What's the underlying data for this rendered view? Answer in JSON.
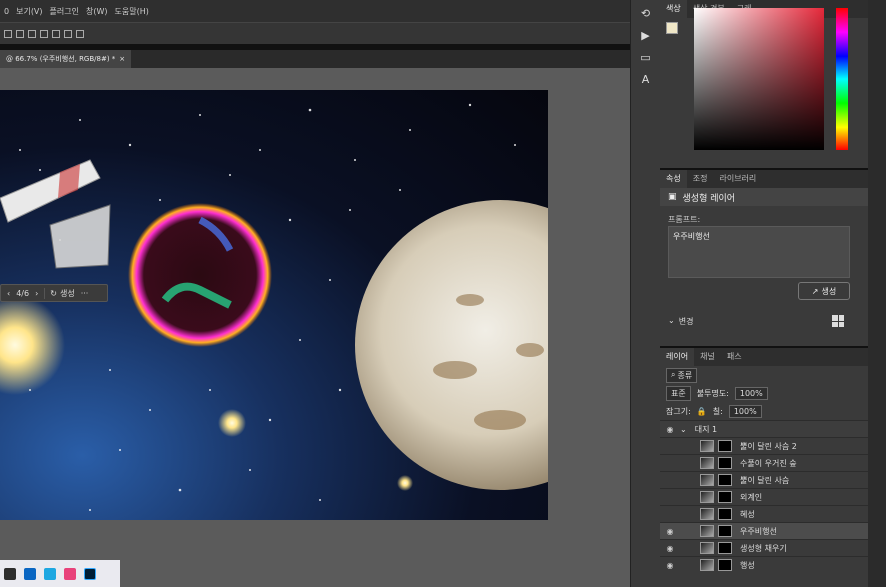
{
  "menubar": {
    "items": [
      "0",
      "보기(V)",
      "플러그인",
      "창(W)",
      "도움말(H)"
    ]
  },
  "document": {
    "tab_title": "@ 66.7% (우주비행선, RGB/8#) *",
    "close": "×"
  },
  "context_bar": {
    "prev": "‹",
    "counter": "4/6",
    "next": "›",
    "generate": "생성",
    "more": "···"
  },
  "color_panel": {
    "tabs": [
      "색상",
      "색상 견본",
      "그레"
    ],
    "foreground": "#f0e7c7",
    "background": "#ffffff"
  },
  "properties": {
    "tabs": [
      "속성",
      "조정",
      "라이브러리"
    ],
    "layer_type": "생성형 레이어",
    "prompt_label": "프롬프트:",
    "prompt_value": "우주비행선",
    "generate_button": "생성",
    "variations_label": "변경"
  },
  "layers": {
    "tabs": [
      "레이어",
      "채널",
      "패스"
    ],
    "filter": "종류",
    "blend_mode": "표준",
    "opacity_label": "불투명도:",
    "opacity": "100%",
    "lock_label": "잠그기:",
    "fill_label": "칠:",
    "fill": "100%",
    "items": [
      {
        "name": "대지 1",
        "type": "group",
        "visible": true
      },
      {
        "name": "뿔이 달린 사슴 2",
        "visible": false
      },
      {
        "name": "수풀이 우거진 숲",
        "visible": false
      },
      {
        "name": "뿔이 달린 사슴",
        "visible": false
      },
      {
        "name": "외계인",
        "visible": false
      },
      {
        "name": "혜성",
        "visible": false
      },
      {
        "name": "우주비행선",
        "visible": true,
        "selected": true
      },
      {
        "name": "생성형 채우기",
        "visible": true
      },
      {
        "name": "행성",
        "visible": true
      }
    ]
  },
  "toolstrip": {
    "icons": [
      "history-icon",
      "play-icon",
      "comment-icon",
      "character-icon"
    ]
  }
}
